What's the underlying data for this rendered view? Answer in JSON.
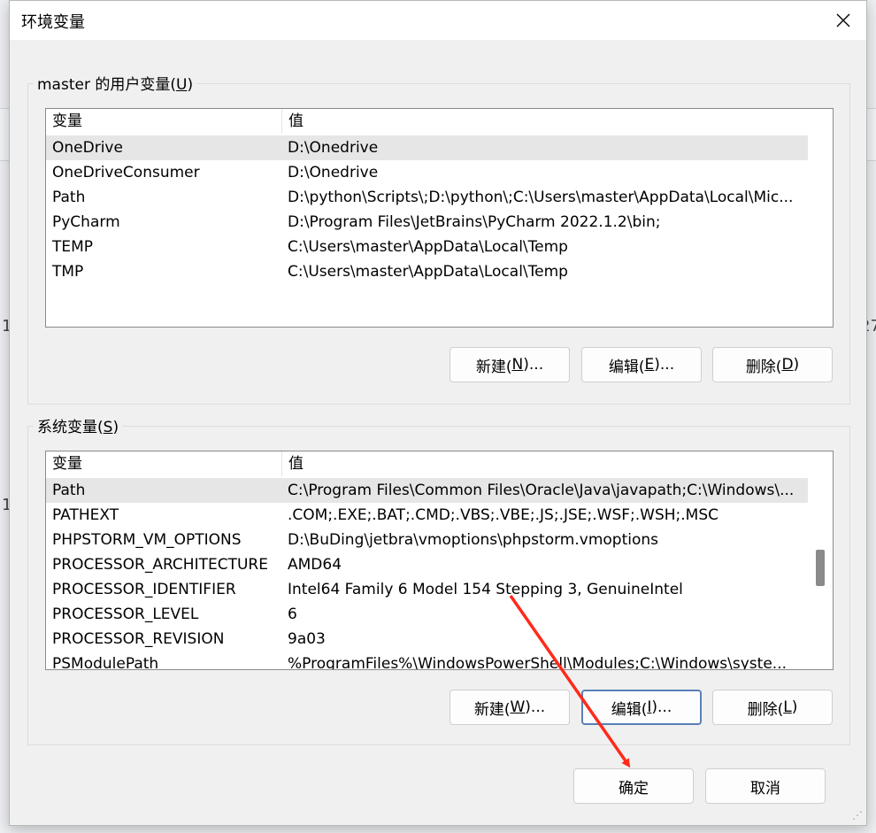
{
  "dialog": {
    "title": "环境变量",
    "close_glyph": "✕"
  },
  "user_vars": {
    "group_label_prefix": "master 的用户变量(",
    "group_label_key": "U",
    "group_label_suffix": ")",
    "headers": [
      "变量",
      "值"
    ],
    "rows": [
      {
        "name": "OneDrive",
        "value": "D:\\Onedrive",
        "selected": true
      },
      {
        "name": "OneDriveConsumer",
        "value": "D:\\Onedrive"
      },
      {
        "name": "Path",
        "value": "D:\\python\\Scripts\\;D:\\python\\;C:\\Users\\master\\AppData\\Local\\Mic..."
      },
      {
        "name": "PyCharm",
        "value": "D:\\Program Files\\JetBrains\\PyCharm 2022.1.2\\bin;"
      },
      {
        "name": "TEMP",
        "value": "C:\\Users\\master\\AppData\\Local\\Temp"
      },
      {
        "name": "TMP",
        "value": "C:\\Users\\master\\AppData\\Local\\Temp"
      }
    ],
    "buttons": {
      "new": {
        "pre": "新建(",
        "key": "N",
        "post": ")..."
      },
      "edit": {
        "pre": "编辑(",
        "key": "E",
        "post": ")..."
      },
      "delete": {
        "pre": "删除(",
        "key": "D",
        "post": ")"
      }
    }
  },
  "system_vars": {
    "group_label_prefix": "系统变量(",
    "group_label_key": "S",
    "group_label_suffix": ")",
    "headers": [
      "变量",
      "值"
    ],
    "rows": [
      {
        "name": "Path",
        "value": "C:\\Program Files\\Common Files\\Oracle\\Java\\javapath;C:\\Windows\\...",
        "selected": true
      },
      {
        "name": "PATHEXT",
        "value": ".COM;.EXE;.BAT;.CMD;.VBS;.VBE;.JS;.JSE;.WSF;.WSH;.MSC"
      },
      {
        "name": "PHPSTORM_VM_OPTIONS",
        "value": "D:\\BuDing\\jetbra\\vmoptions\\phpstorm.vmoptions"
      },
      {
        "name": "PROCESSOR_ARCHITECTURE",
        "value": "AMD64"
      },
      {
        "name": "PROCESSOR_IDENTIFIER",
        "value": "Intel64 Family 6 Model 154 Stepping 3, GenuineIntel"
      },
      {
        "name": "PROCESSOR_LEVEL",
        "value": "6"
      },
      {
        "name": "PROCESSOR_REVISION",
        "value": "9a03"
      },
      {
        "name": "PSModulePath",
        "value": "%ProgramFiles%\\WindowsPowerShell\\Modules;C:\\Windows\\syste..."
      }
    ],
    "buttons": {
      "new": {
        "pre": "新建(",
        "key": "W",
        "post": ")..."
      },
      "edit": {
        "pre": "编辑(",
        "key": "I",
        "post": ")..."
      },
      "delete": {
        "pre": "删除(",
        "key": "L",
        "post": ")"
      }
    }
  },
  "footer": {
    "ok_label": "确定",
    "cancel_label": "取消"
  },
  "background": {
    "glyph_left_1": "1",
    "glyph_left_2": "1",
    "glyph_right": "27"
  },
  "colors": {
    "annotation_arrow": "#ff2a1a",
    "focus_border": "#5a7fb6",
    "scroll_thumb": "#8a8a8a"
  },
  "icons": {
    "close": "close-icon",
    "resize": "resize-grip-icon"
  }
}
